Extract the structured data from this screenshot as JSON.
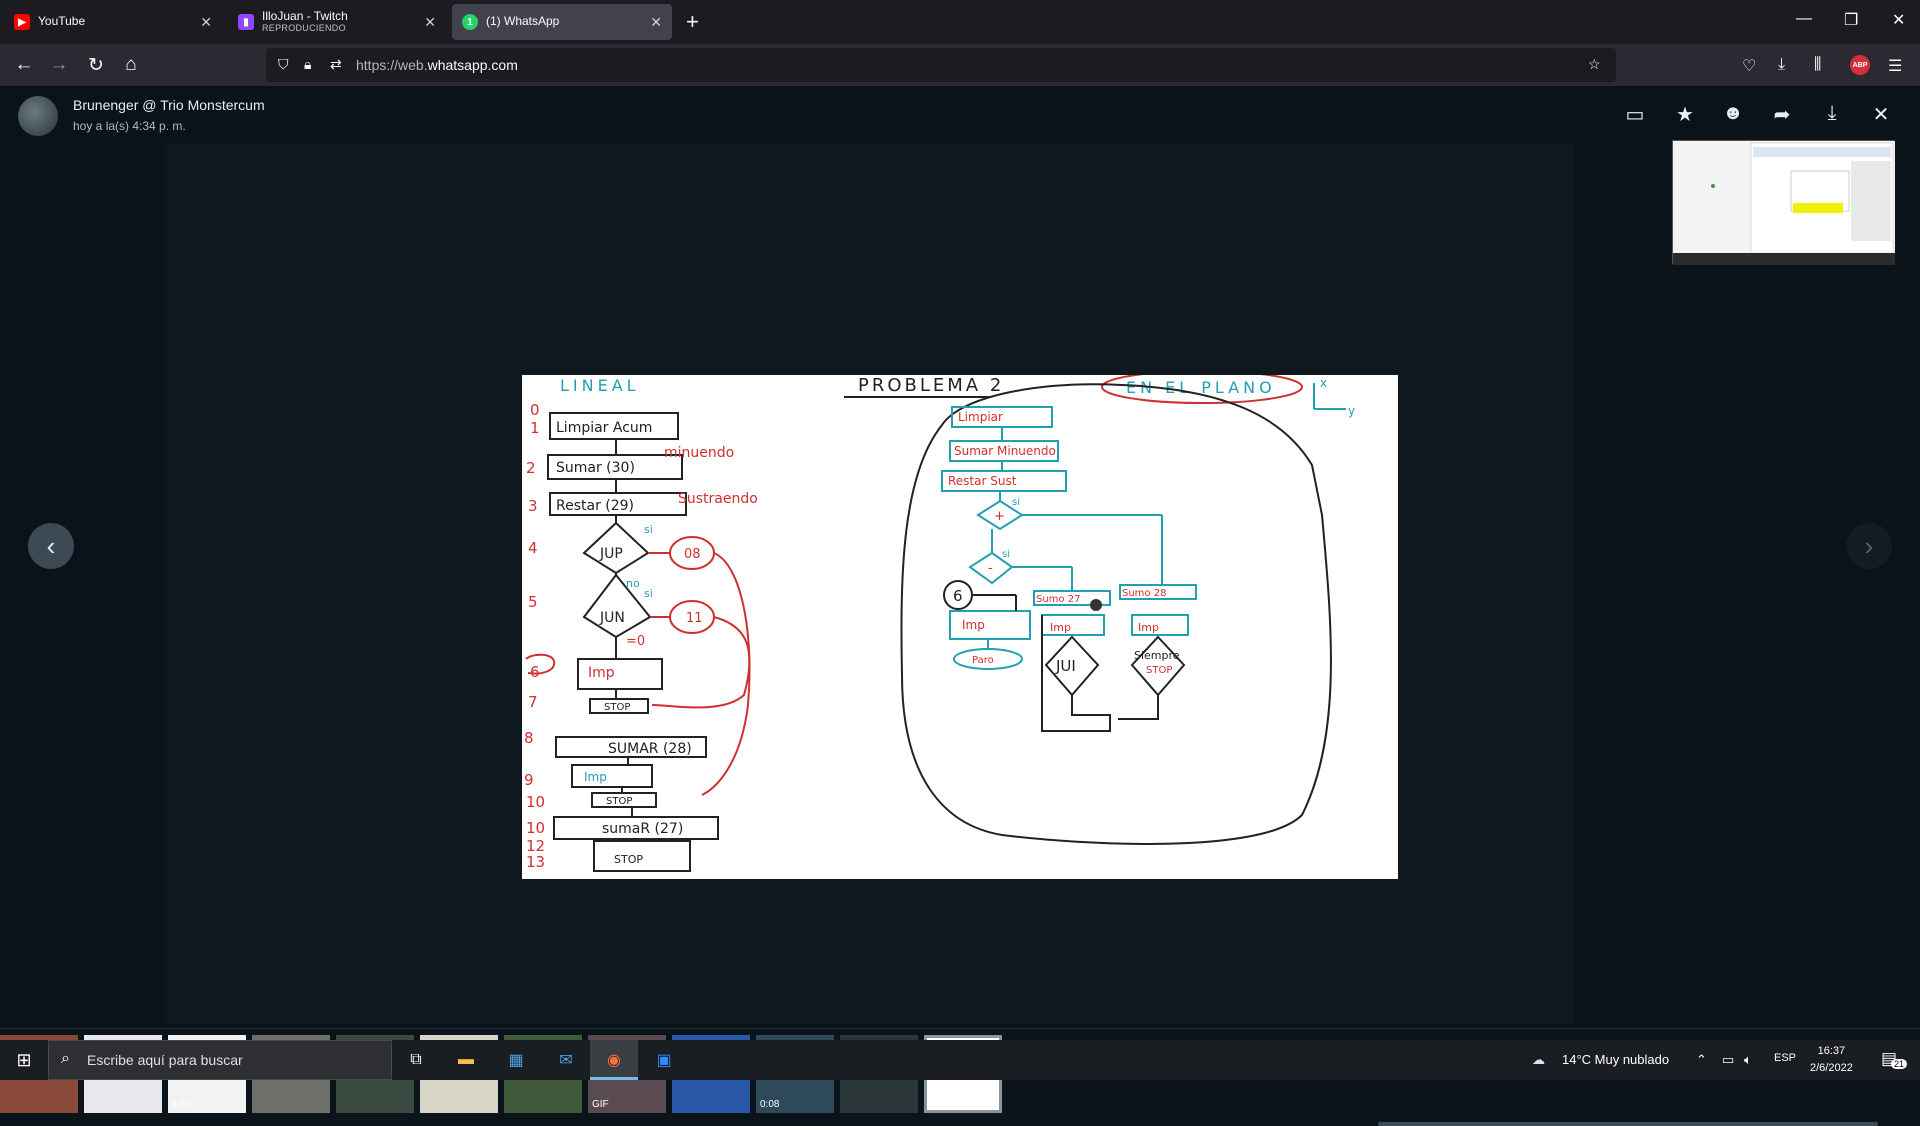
{
  "browser": {
    "tabs": [
      {
        "title": "YouTube",
        "subtitle": "",
        "favicon_color": "#ff0000",
        "favicon_glyph": "▶",
        "active": false
      },
      {
        "title": "IlloJuan - Twitch",
        "subtitle": "REPRODUCIENDO",
        "favicon_color": "#9146ff",
        "favicon_glyph": "▮",
        "active": false
      },
      {
        "title": "(1) WhatsApp",
        "subtitle": "",
        "favicon_color": "#25d366",
        "favicon_glyph": "1",
        "active": true
      }
    ],
    "url_prefix": "https://web.",
    "url_domain": "whatsapp.com",
    "toolbar_icons": [
      "pocket-icon",
      "download-icon",
      "library-icon",
      "adblock-icon",
      "menu-icon"
    ],
    "abp_label": "ABP"
  },
  "viewer": {
    "sender": "Brunenger @ Trio Monstercum",
    "timestamp": "hoy a la(s) 4:34 p. m.",
    "header_icons": [
      "message-icon",
      "star-icon",
      "emoji-icon",
      "forward-icon",
      "download-icon",
      "close-icon"
    ],
    "thumbnails": [
      {
        "kind": "image",
        "label": "",
        "color": "#8a4a3a"
      },
      {
        "kind": "image",
        "label": "",
        "color": "#e8e8ec"
      },
      {
        "kind": "video",
        "label": "1:01",
        "color": "#f2f2f2"
      },
      {
        "kind": "image",
        "label": "",
        "color": "#6e6e6a"
      },
      {
        "kind": "image",
        "label": "",
        "color": "#3a4a40"
      },
      {
        "kind": "image",
        "label": "",
        "color": "#d8d4c8"
      },
      {
        "kind": "image",
        "label": "",
        "color": "#3e5a3a"
      },
      {
        "kind": "gif",
        "label": "GIF",
        "color": "#5a4a52"
      },
      {
        "kind": "image",
        "label": "",
        "color": "#2a58a8"
      },
      {
        "kind": "video",
        "label": "0:08",
        "color": "#2e4a5a"
      },
      {
        "kind": "image",
        "label": "",
        "color": "#2a3638"
      },
      {
        "kind": "image",
        "label": "",
        "color": "#ffffff",
        "selected": true
      }
    ]
  },
  "drawing": {
    "left_title": "LINEAL",
    "center_title": "PROBLEMA 2",
    "right_title": "EN EL PLANO",
    "row_numbers": [
      "0",
      "1",
      "2",
      "3",
      "4",
      "5",
      "6",
      "7",
      "8",
      "9",
      "10",
      "10",
      "12",
      "13"
    ],
    "left_boxes": [
      "Limpiar Acum",
      "Sumar (30)",
      "Restar (29)",
      "JUP",
      "JUN",
      "Imp",
      "STOP",
      "SUMAR (28)",
      "Imp",
      "STOP",
      "sumaR (27)",
      "STOP"
    ],
    "left_notes": [
      "minuendo",
      "Sustraendo",
      "08",
      "11",
      "si",
      "no",
      "si",
      "=0"
    ],
    "right_boxes": [
      "Limpiar",
      "Sumar Minuendo",
      "Restar Sust",
      "+",
      "-",
      "Sumo 27",
      "Sumo 28",
      "Imp",
      "Paro",
      "JUI",
      "Siempre",
      "STOP",
      "6"
    ],
    "right_notes": [
      "si",
      "si",
      "x",
      "y"
    ]
  },
  "taskbar": {
    "search_placeholder": "Escribe aquí para buscar",
    "weather": "14°C  Muy nublado",
    "language": "ESP",
    "time": "16:37",
    "date": "2/6/2022",
    "notifications": "21"
  }
}
